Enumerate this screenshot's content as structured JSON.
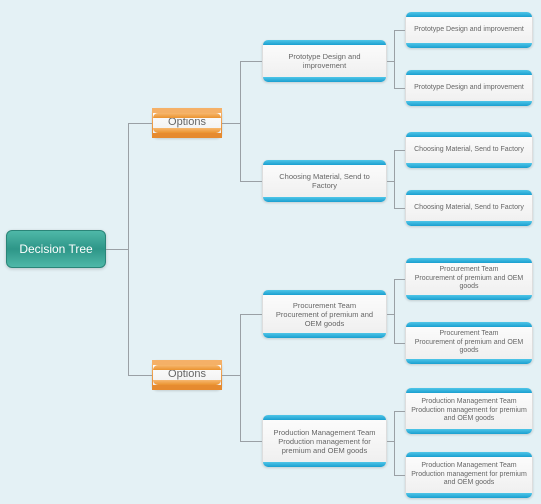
{
  "root": {
    "label": "Decision Tree"
  },
  "level1": [
    {
      "label": "Options"
    },
    {
      "label": "Options"
    }
  ],
  "level2": [
    {
      "label": "Prototype Design and improvement"
    },
    {
      "label": "Choosing Material, Send to Factory"
    },
    {
      "label": "Procurement Team\nProcurement of premium and OEM goods"
    },
    {
      "label": "Production Management Team\nProduction management for premium and OEM goods"
    }
  ],
  "level3": [
    {
      "label": "Prototype Design and improvement"
    },
    {
      "label": "Prototype Design and improvement"
    },
    {
      "label": "Choosing Material, Send to Factory"
    },
    {
      "label": "Choosing Material, Send to Factory"
    },
    {
      "label": "Procurement Team\nProcurement of premium and OEM goods"
    },
    {
      "label": "Procurement Team\nProcurement of premium and OEM goods"
    },
    {
      "label": "Production Management Team\nProduction management for premium and OEM goods"
    },
    {
      "label": "Production Management Team\nProduction management for premium and OEM goods"
    }
  ]
}
